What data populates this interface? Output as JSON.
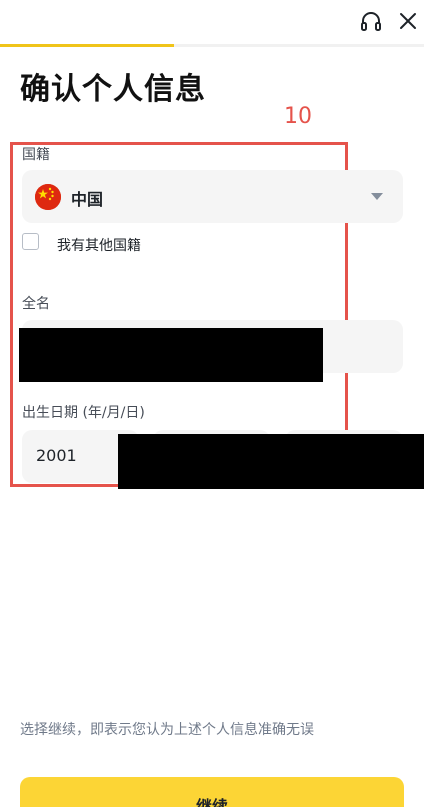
{
  "header": {
    "progress_fraction": 0.41
  },
  "page": {
    "title": "确认个人信息"
  },
  "annotation": {
    "number": "10",
    "color": "#e5534b"
  },
  "nationality": {
    "label": "国籍",
    "selected_value": "中国",
    "flag_icon": "china-flag-icon",
    "other_nationality_label": "我有其他国籍",
    "other_nationality_checked": false
  },
  "full_name": {
    "label": "全名",
    "value_redacted": true
  },
  "dob": {
    "label": "出生日期 (年/月/日)",
    "year": "2001"
  },
  "footer": {
    "disclaimer": "选择继续，即表示您认为上述个人信息准确无误",
    "continue_label": "继续"
  },
  "colors": {
    "accent": "#fcd535",
    "progress": "#f0c419"
  }
}
